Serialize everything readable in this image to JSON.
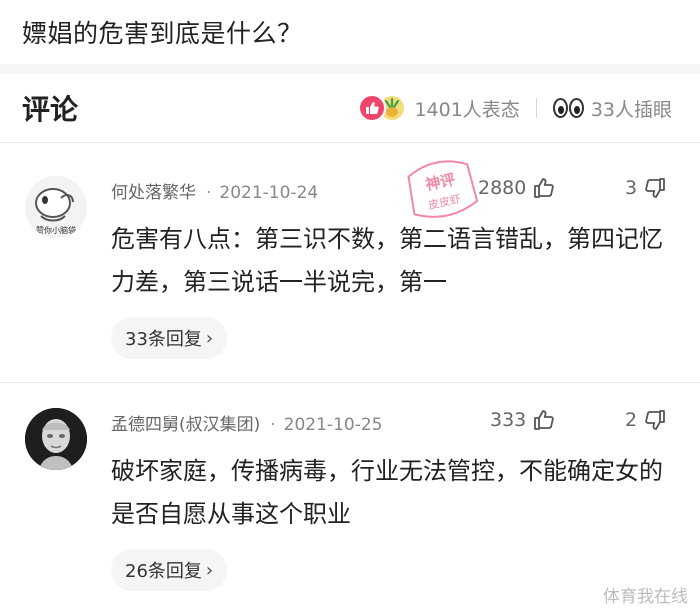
{
  "question": {
    "title": "嫖娼的危害到底是什么？"
  },
  "comments_section": {
    "title": "评论",
    "reactions": {
      "count_label": "1401人表态",
      "like_color": "#f0456b"
    },
    "eyes": {
      "count_label": "33人插眼"
    }
  },
  "stamp": {
    "line1": "神评",
    "line2": "皮皮虾",
    "color": "#f08aa6"
  },
  "comments": [
    {
      "avatar_icon": "cartoon-avatar",
      "avatar_text": "赞你小脑袋",
      "username": "何处落繁华",
      "date": "2021-10-24",
      "likes": "2880",
      "dislikes": "3",
      "body": "危害有八点：第三识不数，第二语言错乱，第四记忆力差，第三说话一半说完，第一",
      "replies_label": "33条回复"
    },
    {
      "avatar_icon": "sculpture-avatar",
      "username": "孟德四舅(叔汉集团)",
      "date": "2021-10-25",
      "likes": "333",
      "dislikes": "2",
      "body": "破坏家庭，传播病毒，行业无法管控，不能确定女的是否自愿从事这个职业",
      "replies_label": "26条回复"
    }
  ],
  "watermark": "体育我在线"
}
